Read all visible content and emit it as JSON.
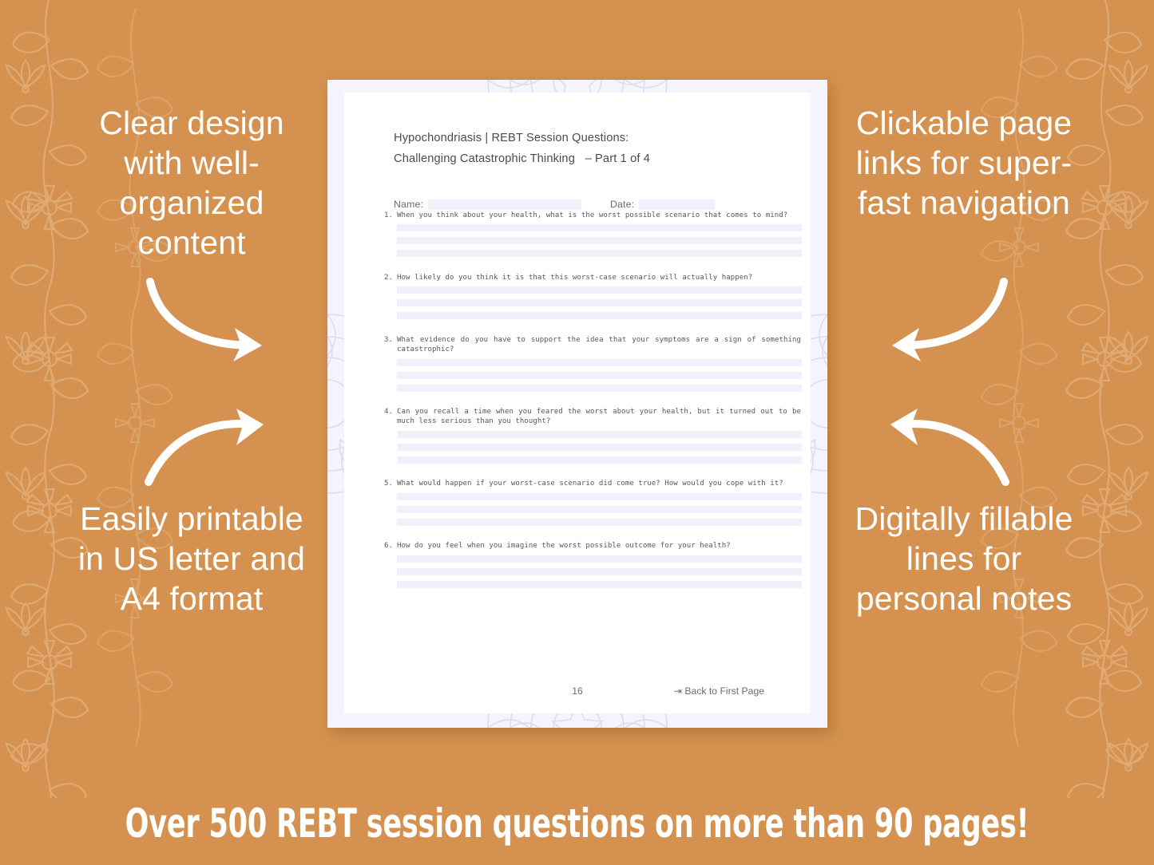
{
  "theme": {
    "background_color": "#d4914f",
    "page_color": "#f5f3fb",
    "sheet_color": "#ffffff",
    "blank_line_color": "#f1effa",
    "text_color": "#ffffff",
    "doc_text_color": "#58585d"
  },
  "promos": {
    "top_left": "Clear design with well-organized content",
    "bottom_left": "Easily printable in US letter and A4 format",
    "top_right": "Clickable page links for super-fast navigation",
    "bottom_right": "Digitally fillable lines for personal notes"
  },
  "document": {
    "title_line_1": "Hypochondriasis | REBT Session Questions:",
    "title_line_2": "Challenging Catastrophic Thinking   – Part 1 of 4",
    "name_label": "Name:",
    "date_label": "Date:",
    "name_value": "",
    "date_value": "",
    "questions": [
      {
        "number": "1.",
        "text": "When you think about your health, what is the worst possible scenario that comes to mind?",
        "answer_lines": 3
      },
      {
        "number": "2.",
        "text": "How likely do you think it is that this worst-case scenario will actually happen?",
        "answer_lines": 3
      },
      {
        "number": "3.",
        "text": "What evidence do you have to support the idea that your symptoms are a sign of something catastrophic?",
        "answer_lines": 3
      },
      {
        "number": "4.",
        "text": "Can you recall a time when you feared the worst about your health, but it turned out to be much less serious than you thought?",
        "answer_lines": 3
      },
      {
        "number": "5.",
        "text": "What would happen if your worst-case scenario did come true? How would you cope with it?",
        "answer_lines": 3
      },
      {
        "number": "6.",
        "text": "How do you feel when you imagine the worst possible outcome for your health?",
        "answer_lines": 3
      }
    ],
    "footer": {
      "page_number": "16",
      "back_link": "⇥ Back to First Page"
    }
  },
  "banner": {
    "text": "Over 500 REBT session questions on more than 90 pages!"
  },
  "icons": {
    "arrow_curved": "curved-arrow-icon",
    "floral_vine": "floral-vine-icon",
    "mandala": "mandala-watermark-icon"
  }
}
